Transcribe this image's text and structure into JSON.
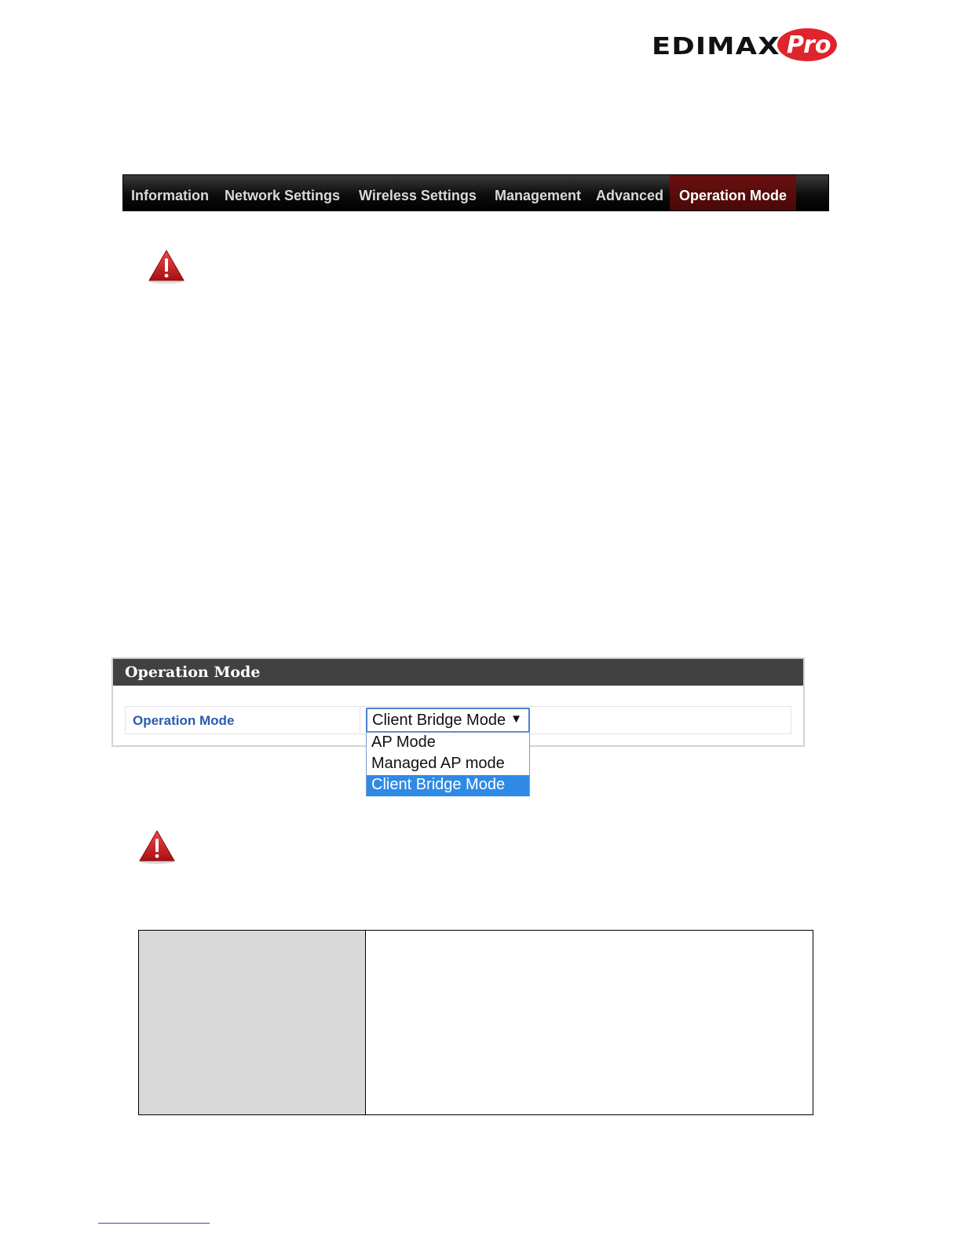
{
  "logo": {
    "brand_text": "EDIMAX",
    "badge_text": "Pro"
  },
  "navbar": {
    "items": [
      {
        "label": "Information"
      },
      {
        "label": "Network Settings"
      },
      {
        "label": "Wireless Settings"
      },
      {
        "label": "Management"
      },
      {
        "label": "Advanced"
      },
      {
        "label": "Operation Mode",
        "active": true
      }
    ],
    "active_color": "#6a1010"
  },
  "icons": [
    "warning-icon",
    "warning-icon"
  ],
  "operation_panel": {
    "title": "Operation Mode",
    "field_label": "Operation Mode",
    "selected_value": "Client Bridge Mode",
    "caret": "▼",
    "options": [
      {
        "label": "AP Mode"
      },
      {
        "label": "Managed AP mode"
      },
      {
        "label": "Client Bridge Mode",
        "selected": true
      }
    ]
  },
  "colors": {
    "warning_red": "#c8161d",
    "link_blue": "#2a5bb0",
    "highlight_blue": "#2f8ae6"
  }
}
